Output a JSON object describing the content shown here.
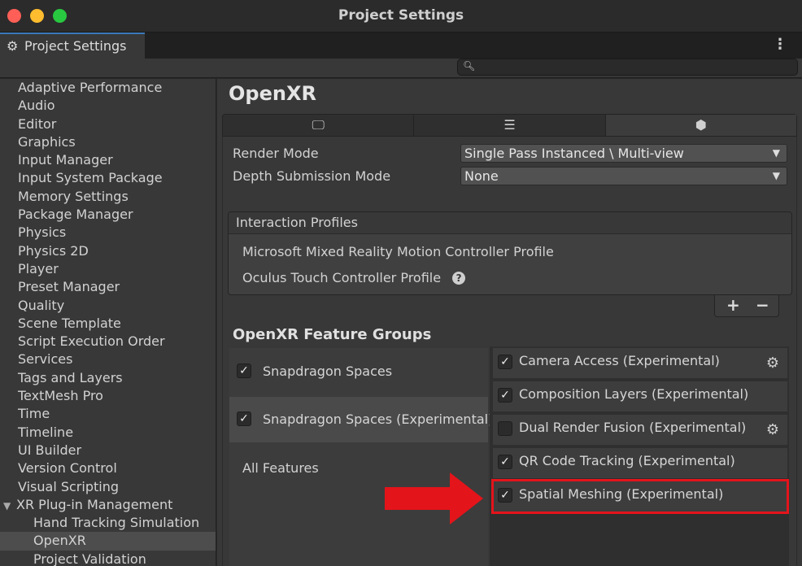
{
  "window": {
    "title": "Project Settings"
  },
  "tab": {
    "label": "Project Settings",
    "icon": "gear-icon"
  },
  "search": {
    "placeholder": ""
  },
  "sidebar": {
    "items": [
      {
        "label": "Adaptive Performance"
      },
      {
        "label": "Audio"
      },
      {
        "label": "Editor"
      },
      {
        "label": "Graphics"
      },
      {
        "label": "Input Manager"
      },
      {
        "label": "Input System Package"
      },
      {
        "label": "Memory Settings"
      },
      {
        "label": "Package Manager"
      },
      {
        "label": "Physics"
      },
      {
        "label": "Physics 2D"
      },
      {
        "label": "Player"
      },
      {
        "label": "Preset Manager"
      },
      {
        "label": "Quality"
      },
      {
        "label": "Scene Template"
      },
      {
        "label": "Script Execution Order"
      },
      {
        "label": "Services"
      },
      {
        "label": "Tags and Layers"
      },
      {
        "label": "TextMesh Pro"
      },
      {
        "label": "Time"
      },
      {
        "label": "Timeline"
      },
      {
        "label": "UI Builder"
      },
      {
        "label": "Version Control"
      },
      {
        "label": "Visual Scripting"
      },
      {
        "label": "XR Plug-in Management"
      },
      {
        "label": "Hand Tracking Simulation"
      },
      {
        "label": "OpenXR"
      },
      {
        "label": "Project Validation"
      }
    ]
  },
  "main": {
    "title": "OpenXR",
    "platform_tabs": [
      {
        "icon": "monitor-icon"
      },
      {
        "icon": "server-icon"
      },
      {
        "icon": "android-icon"
      }
    ],
    "render_mode": {
      "label": "Render Mode",
      "value": "Single Pass Instanced \\ Multi-view"
    },
    "depth_mode": {
      "label": "Depth Submission Mode",
      "value": "None"
    },
    "interaction_profiles": {
      "title": "Interaction Profiles",
      "items": [
        {
          "label": "Microsoft Mixed Reality Motion Controller Profile"
        },
        {
          "label": "Oculus Touch Controller Profile"
        }
      ],
      "add": "+",
      "remove": "−"
    },
    "feature_groups": {
      "title": "OpenXR Feature Groups",
      "groups": [
        {
          "label": "Snapdragon Spaces",
          "checked": true
        },
        {
          "label": "Snapdragon Spaces (Experimental)",
          "checked": true
        }
      ],
      "all_features": "All Features"
    },
    "features": [
      {
        "label": "Camera Access (Experimental)",
        "checked": true,
        "has_settings": true
      },
      {
        "label": "Composition Layers (Experimental)",
        "checked": true,
        "has_settings": false
      },
      {
        "label": "Dual Render Fusion (Experimental)",
        "checked": false,
        "has_settings": true
      },
      {
        "label": "QR Code Tracking (Experimental)",
        "checked": true,
        "has_settings": false
      },
      {
        "label": "Spatial Meshing (Experimental)",
        "checked": true,
        "has_settings": false
      }
    ]
  },
  "colors": {
    "highlight": "#e4141b",
    "accent": "#3a79bb"
  }
}
